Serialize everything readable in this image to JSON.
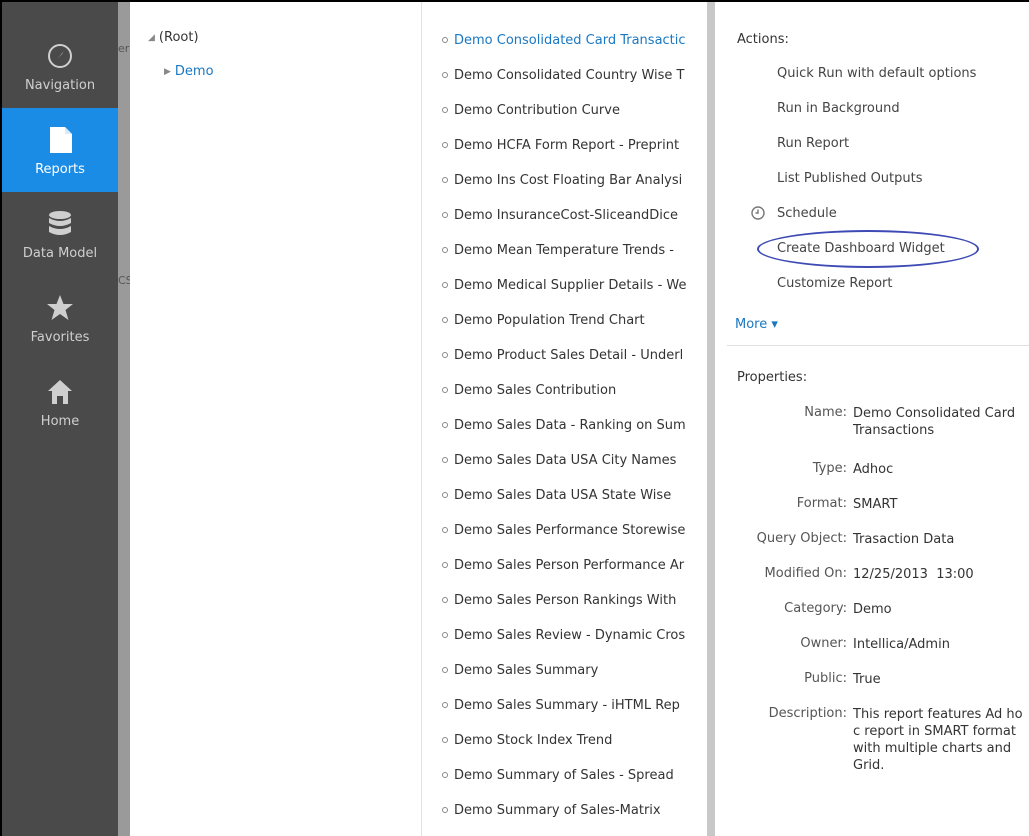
{
  "nav": {
    "items": [
      {
        "label": "Navigation",
        "icon": "compass-icon"
      },
      {
        "label": "Reports",
        "icon": "document-icon"
      },
      {
        "label": "Data Model",
        "icon": "database-icon"
      },
      {
        "label": "Favorites",
        "icon": "star-icon"
      },
      {
        "label": "Home",
        "icon": "home-icon"
      }
    ],
    "active_color": "#1a8ce6"
  },
  "tree": {
    "root": "(Root)",
    "child": "Demo"
  },
  "reports": [
    "Demo Consolidated Card Transactic",
    "Demo Consolidated Country Wise T",
    "Demo Contribution Curve",
    "Demo HCFA Form Report - Preprint",
    "Demo Ins Cost Floating Bar Analysi",
    "Demo InsuranceCost-SliceandDice",
    "Demo Mean Temperature Trends -",
    "Demo Medical Supplier Details - We",
    "Demo Population Trend Chart",
    "Demo Product Sales Detail - Underl",
    "Demo Sales Contribution",
    "Demo Sales Data - Ranking on Sum",
    "Demo Sales Data USA City Names",
    "Demo Sales Data USA State Wise",
    "Demo Sales Performance Storewise",
    "Demo Sales Person Performance Ar",
    "Demo Sales Person Rankings With",
    "Demo Sales Review - Dynamic Cros",
    "Demo Sales Summary",
    "Demo Sales Summary - iHTML Rep",
    "Demo Stock Index Trend",
    "Demo Summary of Sales - Spread",
    "Demo Summary of Sales-Matrix"
  ],
  "actions": {
    "title": "Actions:",
    "quick_run": "Quick Run with default options",
    "run_background": "Run in Background",
    "run_report": "Run Report",
    "list_published": "List Published Outputs",
    "schedule": "Schedule",
    "create_widget": "Create Dashboard Widget",
    "customize": "Customize Report",
    "more": "More ▾"
  },
  "properties": {
    "title": "Properties:",
    "name_label": "Name:",
    "name_value_1": "Demo Consolidated Card",
    "name_value_2": "Transactions",
    "type_label": "Type:",
    "type_value": "Adhoc",
    "format_label": "Format:",
    "format_value": "SMART",
    "query_label": "Query Object:",
    "query_value": "Trasaction Data",
    "modified_label": "Modified On:",
    "modified_value": "12/25/2013  13:00",
    "category_label": "Category:",
    "category_value": "Demo",
    "owner_label": "Owner:",
    "owner_value": "Intellica/Admin",
    "public_label": "Public:",
    "public_value": "True",
    "description_label": "Description:",
    "description_1": "This report features Ad ho",
    "description_2": "c report in SMART format",
    "description_3": "with multiple charts and",
    "description_4": "Grid."
  },
  "strip_text": {
    "a": "er",
    "b": "CS"
  }
}
